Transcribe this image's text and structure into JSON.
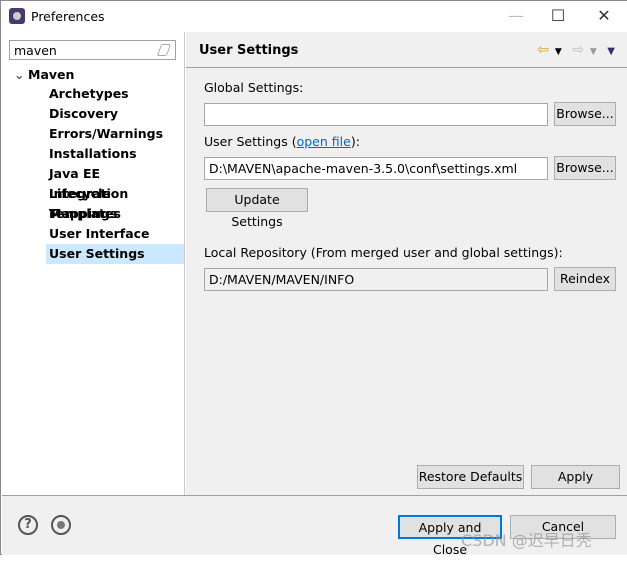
{
  "window": {
    "title": "Preferences",
    "minimize": "—",
    "maximize": "☐",
    "close": "✕"
  },
  "sidebar": {
    "search_value": "maven",
    "root": "Maven",
    "items": [
      {
        "label": "Archetypes"
      },
      {
        "label": "Discovery"
      },
      {
        "label": "Errors/Warnings"
      },
      {
        "label": "Installations"
      },
      {
        "label": "Java EE Integration"
      },
      {
        "label": "Lifecycle Mappings"
      },
      {
        "label": "Templates"
      },
      {
        "label": "User Interface"
      },
      {
        "label": "User Settings",
        "selected": true
      }
    ]
  },
  "page": {
    "title": "User Settings",
    "back_icon": "⇦",
    "forward_icon": "⇨",
    "menu_icon": "▼",
    "global_label": "Global Settings:",
    "global_value": "",
    "browse": "Browse...",
    "user_label_pre": "User Settings (",
    "user_link": "open file",
    "user_label_post": "):",
    "user_value": "D:\\MAVEN\\apache-maven-3.5.0\\conf\\settings.xml",
    "update": "Update Settings",
    "local_label": "Local Repository (From merged user and global settings):",
    "local_value": "D:/MAVEN/MAVEN/INFO",
    "reindex": "Reindex",
    "restore": "Restore Defaults",
    "apply": "Apply"
  },
  "footer": {
    "help": "?",
    "apply_close": "Apply and Close",
    "cancel": "Cancel"
  },
  "watermark": "CSDN @迟早日秃"
}
